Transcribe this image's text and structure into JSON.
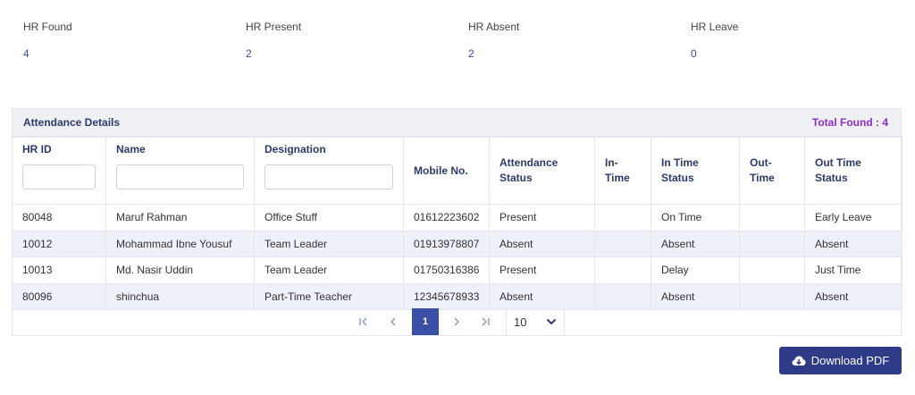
{
  "stats": [
    {
      "label": "HR Found",
      "value": "4"
    },
    {
      "label": "HR Present",
      "value": "2"
    },
    {
      "label": "HR Absent",
      "value": "2"
    },
    {
      "label": "HR Leave",
      "value": "0"
    }
  ],
  "panel": {
    "title": "Attendance Details",
    "total_found": "Total Found : 4"
  },
  "table": {
    "headers": {
      "hr_id": "HR ID",
      "name": "Name",
      "designation": "Designation",
      "mobile": "Mobile No.",
      "attendance_status": "Attendance Status",
      "in_time": "In-Time",
      "in_time_status": "In Time Status",
      "out_time": "Out-Time",
      "out_time_status": "Out Time Status"
    },
    "rows": [
      {
        "hr_id": "80048",
        "name": "Maruf Rahman",
        "designation": "Office Stuff",
        "mobile": "01612223602",
        "attendance_status": "Present",
        "in_time": "",
        "in_time_status": "On Time",
        "out_time": "",
        "out_time_status": "Early Leave"
      },
      {
        "hr_id": "10012",
        "name": "Mohammad Ibne Yousuf",
        "designation": "Team Leader",
        "mobile": "01913978807",
        "attendance_status": "Absent",
        "in_time": "",
        "in_time_status": "Absent",
        "out_time": "",
        "out_time_status": "Absent"
      },
      {
        "hr_id": "10013",
        "name": "Md. Nasir Uddin",
        "designation": "Team Leader",
        "mobile": "01750316386",
        "attendance_status": "Present",
        "in_time": "",
        "in_time_status": "Delay",
        "out_time": "",
        "out_time_status": "Just Time"
      },
      {
        "hr_id": "80096",
        "name": "shinchua",
        "designation": "Part-Time Teacher",
        "mobile": "12345678933",
        "attendance_status": "Absent",
        "in_time": "",
        "in_time_status": "Absent",
        "out_time": "",
        "out_time_status": "Absent"
      }
    ]
  },
  "pagination": {
    "current_page": "1",
    "page_size": "10"
  },
  "download": {
    "label": "Download PDF"
  },
  "colors": {
    "accent": "#2e3b86",
    "total_found": "#8a2fc9",
    "alt_row": "#eef0fa"
  }
}
